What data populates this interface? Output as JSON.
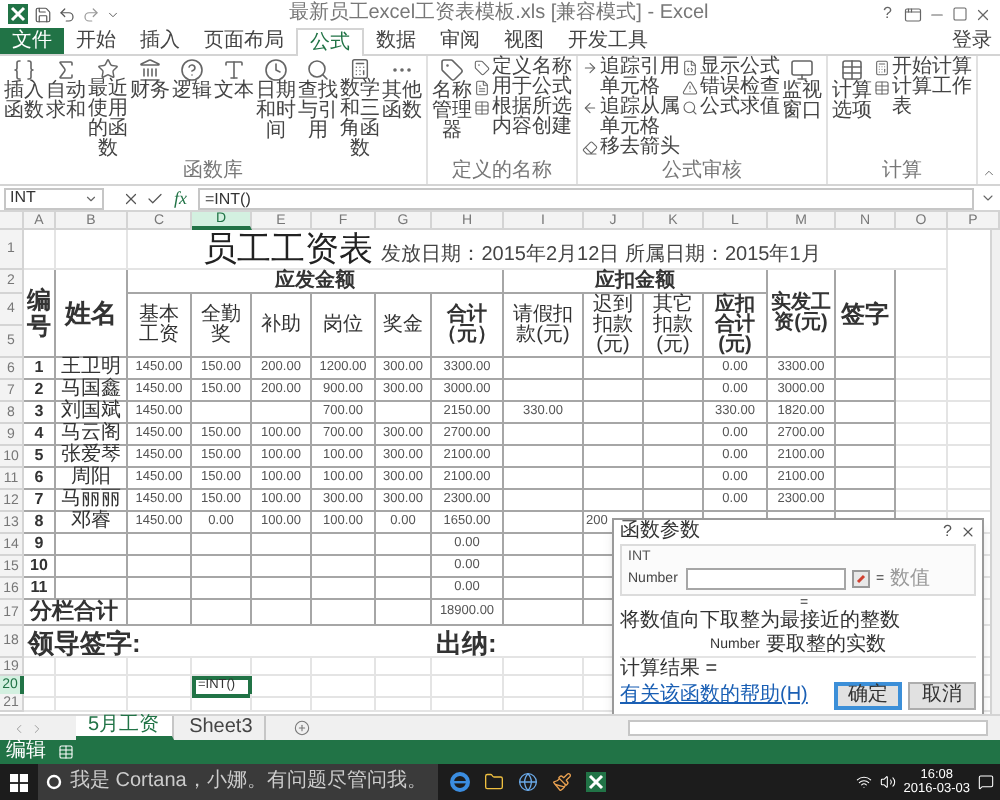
{
  "title_bar": {
    "title": "最新员工excel工资表模板.xls [兼容模式] - Excel",
    "help": "?"
  },
  "tabs": [
    {
      "label": "文件",
      "kind": "file",
      "selected": false
    },
    {
      "label": "开始",
      "kind": "tab",
      "selected": false
    },
    {
      "label": "插入",
      "kind": "tab",
      "selected": false
    },
    {
      "label": "页面布局",
      "kind": "tab",
      "selected": false
    },
    {
      "label": "公式",
      "kind": "tab",
      "selected": true
    },
    {
      "label": "数据",
      "kind": "tab",
      "selected": false
    },
    {
      "label": "审阅",
      "kind": "tab",
      "selected": false
    },
    {
      "label": "视图",
      "kind": "tab",
      "selected": false
    },
    {
      "label": "开发工具",
      "kind": "tab",
      "selected": false
    }
  ],
  "sign_in": "登录",
  "ribbon": {
    "groups": [
      {
        "label": "函数库",
        "items": [
          {
            "kind": "large",
            "label": "插入函数"
          },
          {
            "kind": "large",
            "label": "自动求和"
          },
          {
            "kind": "large",
            "label": "最近使用的函数"
          },
          {
            "kind": "large",
            "label": "财务"
          },
          {
            "kind": "large",
            "label": "逻辑"
          },
          {
            "kind": "large",
            "label": "文本"
          },
          {
            "kind": "large",
            "label": "日期和时间"
          },
          {
            "kind": "large",
            "label": "查找与引用"
          },
          {
            "kind": "large",
            "label": "数学和三角函数"
          },
          {
            "kind": "large",
            "label": "其他函数"
          }
        ]
      },
      {
        "label": "定义的名称",
        "items": [
          {
            "kind": "large",
            "label": "名称管理器"
          },
          {
            "kind": "stack",
            "items": [
              "定义名称",
              "用于公式",
              "根据所选内容创建"
            ]
          }
        ]
      },
      {
        "label": "公式审核",
        "items": [
          {
            "kind": "stack",
            "items": [
              "追踪引用单元格",
              "追踪从属单元格",
              "移去箭头"
            ]
          },
          {
            "kind": "stack",
            "items": [
              "显示公式",
              "错误检查",
              "公式求值"
            ]
          },
          {
            "kind": "large",
            "label": "监视窗口"
          }
        ]
      },
      {
        "label": "计算",
        "items": [
          {
            "kind": "large",
            "label": "计算选项"
          },
          {
            "kind": "stack",
            "items": [
              "开始计算",
              "计算工作表"
            ]
          }
        ]
      }
    ]
  },
  "formula_bar": {
    "name_box": "INT",
    "fx": "fx",
    "formula": "=INT()"
  },
  "columns": [
    {
      "label": "A",
      "selected": false
    },
    {
      "label": "B",
      "selected": false
    },
    {
      "label": "C",
      "selected": false
    },
    {
      "label": "D",
      "selected": true
    },
    {
      "label": "E",
      "selected": false
    },
    {
      "label": "F",
      "selected": false
    },
    {
      "label": "G",
      "selected": false
    },
    {
      "label": "H",
      "selected": false
    },
    {
      "label": "I",
      "selected": false
    },
    {
      "label": "J",
      "selected": false
    },
    {
      "label": "K",
      "selected": false
    },
    {
      "label": "L",
      "selected": false
    },
    {
      "label": "M",
      "selected": false
    },
    {
      "label": "N",
      "selected": false
    },
    {
      "label": "O",
      "selected": false
    },
    {
      "label": "P",
      "selected": false
    }
  ],
  "title_row": {
    "row": "1",
    "title": "员工工资表",
    "dates": "发放日期：2015年2月12日 所属日期：2015年1月"
  },
  "header": {
    "row_numbers": [
      "2",
      "4",
      "5"
    ],
    "number": "编号",
    "name": "姓名",
    "payable": "应发金额",
    "payable_columns": [
      "基本工资",
      "全勤奖",
      "补助",
      "岗位",
      "奖金",
      "合计（元）"
    ],
    "deductions": "应扣金额",
    "deduction_columns": [
      "请假扣款(元)",
      "迟到扣款(元)",
      "其它扣款(元)",
      "应扣合计(元)"
    ],
    "net_pay": "实发工资(元)",
    "signature": "签字"
  },
  "rows": [
    {
      "row": "6",
      "no": "1",
      "name": "王卫明",
      "c": "1450.00",
      "d": "150.00",
      "e": "200.00",
      "f": "1200.00",
      "g": "300.00",
      "h": "3300.00",
      "l": "0.00",
      "m": "3300.00"
    },
    {
      "row": "7",
      "no": "2",
      "name": "马国鑫",
      "c": "1450.00",
      "d": "150.00",
      "e": "200.00",
      "f": "900.00",
      "g": "300.00",
      "h": "3000.00",
      "l": "0.00",
      "m": "3000.00"
    },
    {
      "row": "8",
      "no": "3",
      "name": "刘国斌",
      "c": "1450.00",
      "f": "700.00",
      "h": "2150.00",
      "i": "330.00",
      "l": "330.00",
      "m": "1820.00"
    },
    {
      "row": "9",
      "no": "4",
      "name": "马云阁",
      "c": "1450.00",
      "d": "150.00",
      "e": "100.00",
      "f": "700.00",
      "g": "300.00",
      "h": "2700.00",
      "l": "0.00",
      "m": "2700.00"
    },
    {
      "row": "10",
      "no": "5",
      "name": "张爱琴",
      "c": "1450.00",
      "d": "150.00",
      "e": "100.00",
      "f": "100.00",
      "g": "300.00",
      "h": "2100.00",
      "l": "0.00",
      "m": "2100.00"
    },
    {
      "row": "11",
      "no": "6",
      "name": "周阳",
      "c": "1450.00",
      "d": "150.00",
      "e": "100.00",
      "f": "100.00",
      "g": "300.00",
      "h": "2100.00",
      "l": "0.00",
      "m": "2100.00"
    },
    {
      "row": "12",
      "no": "7",
      "name": "马丽丽",
      "c": "1450.00",
      "d": "150.00",
      "e": "100.00",
      "f": "300.00",
      "g": "300.00",
      "h": "2300.00",
      "l": "0.00",
      "m": "2300.00"
    },
    {
      "row": "13",
      "no": "8",
      "name": "邓睿",
      "c": "1450.00",
      "d": "0.00",
      "e": "100.00",
      "f": "100.00",
      "g": "0.00",
      "h": "1650.00",
      "j": "200"
    },
    {
      "row": "14",
      "no": "9",
      "h": "0.00"
    },
    {
      "row": "15",
      "no": "10",
      "h": "0.00"
    },
    {
      "row": "16",
      "no": "11",
      "h": "0.00"
    }
  ],
  "subtotal": {
    "row": "17",
    "label": "分栏合计",
    "h": "18900.00"
  },
  "sign_row": {
    "row": "18",
    "leader": "领导签字:",
    "cashier": "出纳:"
  },
  "empty_rows": [
    {
      "row": "19",
      "selected": false
    },
    {
      "row": "20",
      "selected": true,
      "active_cell": "=INT()"
    },
    {
      "row": "21",
      "selected": false
    }
  ],
  "dialog": {
    "title": "函数参数",
    "help": "?",
    "function": "INT",
    "argument": "Number",
    "equals": "=",
    "hint": "数值",
    "result_equals": "=",
    "description": "将数值向下取整为最接近的整数",
    "arg_name": "Number",
    "arg_help": "要取整的实数",
    "result_label": "计算结果 =",
    "help_link": "有关该函数的帮助(H)",
    "buttons": [
      {
        "label": "确定",
        "default": true
      },
      {
        "label": "取消",
        "default": false
      }
    ]
  },
  "sheet_tabs": [
    {
      "label": "5月工资",
      "selected": true
    },
    {
      "label": "Sheet3",
      "selected": false
    }
  ],
  "status": "编辑",
  "taskbar": {
    "search": "我是 Cortana，小娜。有问题尽管问我。",
    "time": "16:08",
    "date": "2016-03-03"
  }
}
